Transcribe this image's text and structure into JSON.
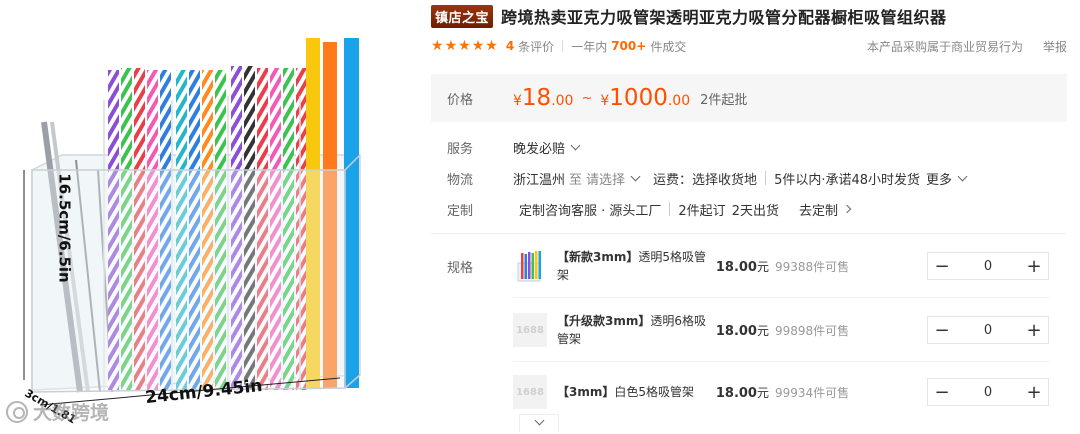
{
  "image": {
    "dim_height": "16.5cm/6.5in",
    "dim_width": "24cm/9.45in",
    "dim_depth": "3cm/1.81",
    "watermark": "大数跨境"
  },
  "header": {
    "shop_badge": "镇店之宝",
    "title": "跨境热卖亚克力吸管架透明亚克力吸管分配器橱柜吸管组织器"
  },
  "rating": {
    "stars": 5,
    "review_count": "4",
    "review_suffix": "条评价",
    "year_prefix": "一年内",
    "sold_count": "700+",
    "sold_suffix": "件成交",
    "notice": "本产品采购属于商业贸易行为",
    "report": "举报"
  },
  "price": {
    "label": "价格",
    "currency": "¥",
    "low_int": "18",
    "low_dec": ".00",
    "tilde": "~",
    "high_int": "1000",
    "high_dec": ".00",
    "moq": "2件起批"
  },
  "service": {
    "label": "服务",
    "value": "晚发必赔"
  },
  "logistics": {
    "label": "物流",
    "from": "浙江温州",
    "to_prefix": "至",
    "to_placeholder": "请选择",
    "shipping": "运费：选择收货地",
    "promise": "5件以内·承诺48小时发货",
    "more": "更多"
  },
  "customize": {
    "label": "定制",
    "service": "定制咨询客服 · 源头工厂",
    "min_order": "2件起订",
    "lead_time": "2天出货",
    "link": "去定制"
  },
  "specs": {
    "label": "规格",
    "items": [
      {
        "tag": "【新款3mm】",
        "name": "透明5格吸管架",
        "price": "18.00",
        "unit": "元",
        "stock": "99388件可售",
        "qty": "0",
        "thumb": "photo"
      },
      {
        "tag": "【升级款3mm】",
        "name": "透明6格吸管架",
        "price": "18.00",
        "unit": "元",
        "stock": "99898件可售",
        "qty": "0",
        "thumb": "1688"
      },
      {
        "tag": "【3mm】",
        "name": "白色5格吸管架",
        "price": "18.00",
        "unit": "元",
        "stock": "99934件可售",
        "qty": "0",
        "thumb": "1688"
      }
    ],
    "minus": "−",
    "plus": "+"
  },
  "colors": {
    "accent": "#ff5000",
    "star": "#ff7300",
    "badge": "#7a2400"
  }
}
